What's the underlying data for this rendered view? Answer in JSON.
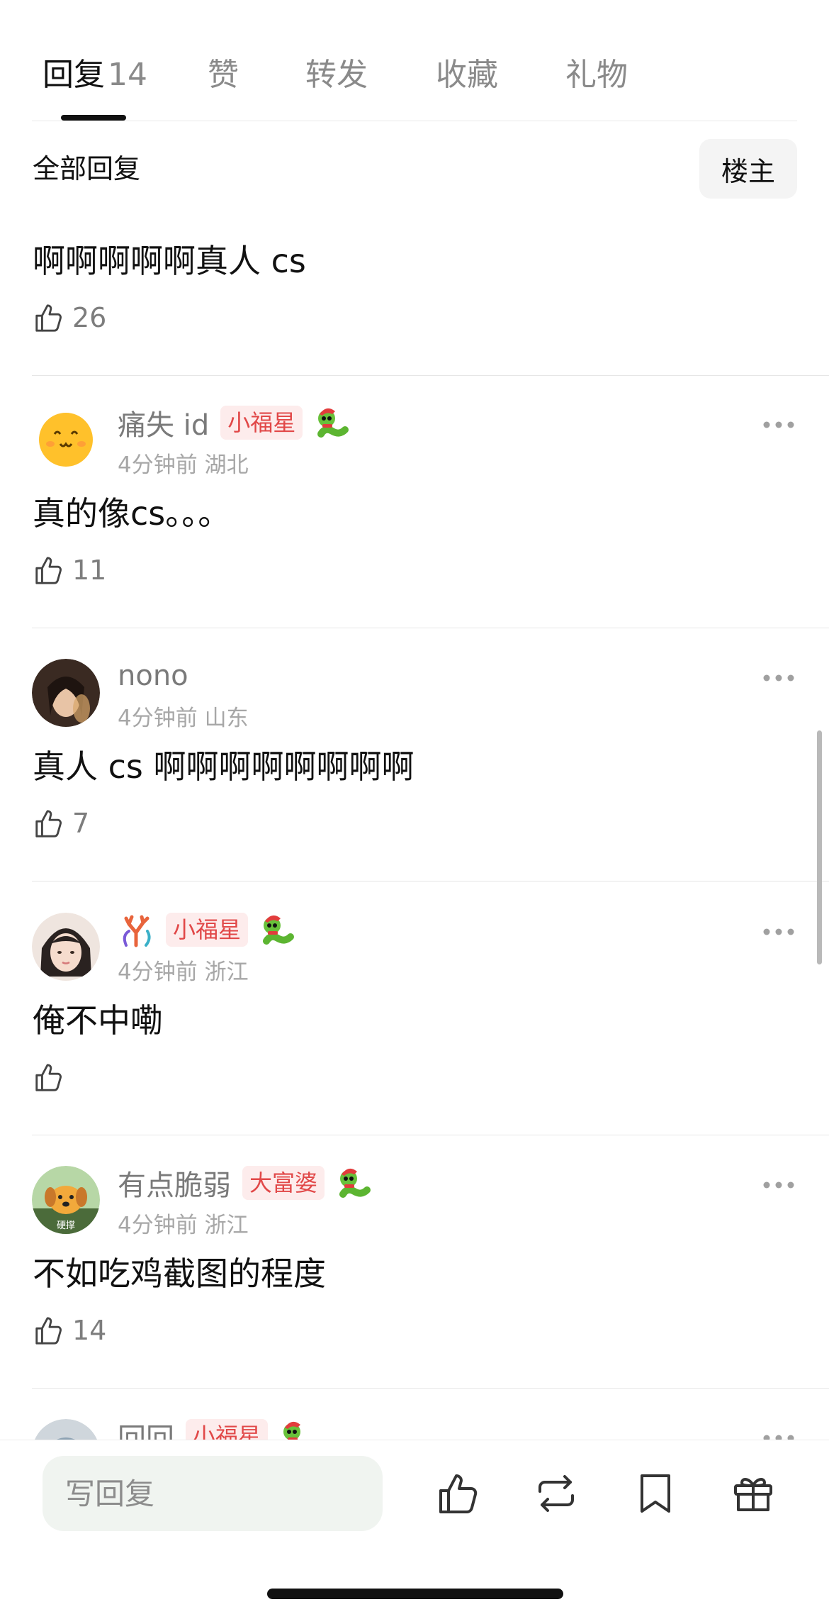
{
  "tabs": [
    {
      "label": "回复",
      "count": "14",
      "active": true
    },
    {
      "label": "赞"
    },
    {
      "label": "转发"
    },
    {
      "label": "收藏"
    },
    {
      "label": "礼物"
    }
  ],
  "filter": {
    "title": "全部回复",
    "op_button": "楼主"
  },
  "comments": [
    {
      "content": "啊啊啊啊啊真人 cs",
      "likes": "26"
    },
    {
      "username": "痛失 id",
      "badge": "小福星",
      "time": "4分钟前",
      "location": "湖北",
      "content": "真的像cs。。。",
      "likes": "11"
    },
    {
      "username": "nono",
      "badge": "",
      "time": "4分钟前",
      "location": "山东",
      "content": "真人 cs 啊啊啊啊啊啊啊啊",
      "likes": "7"
    },
    {
      "username": "",
      "badge": "小福星",
      "time": "4分钟前",
      "location": "浙江",
      "content": "俺不中嘞",
      "likes": ""
    },
    {
      "username": "有点脆弱",
      "badge": "大富婆",
      "time": "4分钟前",
      "location": "浙江",
      "content": "不如吃鸡截图的程度",
      "likes": "14"
    },
    {
      "username": "回回",
      "badge": "小福星"
    }
  ],
  "avatar_text": {
    "dog_label": "硬撑"
  },
  "reply_box": {
    "placeholder": "写回复"
  },
  "icons": [
    "thumb-up-icon",
    "repost-icon",
    "bookmark-icon",
    "gift-icon",
    "more-icon",
    "snake-emoji-icon",
    "coral-emoji-icon"
  ],
  "colors": {
    "badge_text": "#e14848",
    "badge_bg": "#fdecec",
    "meta": "#a7a7a7"
  }
}
